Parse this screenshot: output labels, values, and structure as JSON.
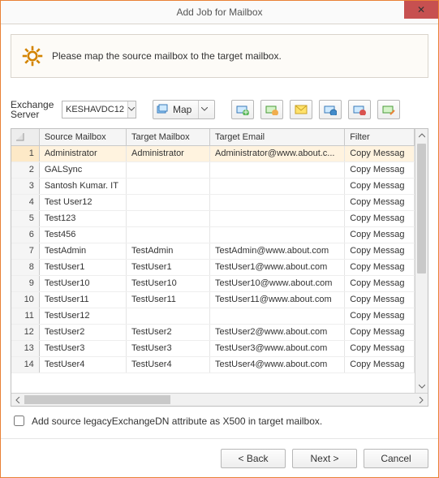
{
  "window": {
    "title": "Add Job for Mailbox"
  },
  "banner": {
    "text": "Please map the source mailbox to the target mailbox."
  },
  "server": {
    "label": "Exchange Server",
    "value": "KESHAVDC12"
  },
  "map_button": {
    "label": "Map"
  },
  "columns": {
    "rownum": "",
    "source": "Source Mailbox",
    "target": "Target Mailbox",
    "email": "Target Email",
    "filter": "Filter"
  },
  "rows": [
    {
      "n": "1",
      "src": "Administrator",
      "tgt": "Administrator",
      "email": "Administrator@www.about.c...",
      "filter": "Copy Messag"
    },
    {
      "n": "2",
      "src": "GALSync",
      "tgt": "",
      "email": "",
      "filter": "Copy Messag"
    },
    {
      "n": "3",
      "src": "Santosh Kumar. IT",
      "tgt": "",
      "email": "",
      "filter": "Copy Messag"
    },
    {
      "n": "4",
      "src": "Test User12",
      "tgt": "",
      "email": "",
      "filter": "Copy Messag"
    },
    {
      "n": "5",
      "src": "Test123",
      "tgt": "",
      "email": "",
      "filter": "Copy Messag"
    },
    {
      "n": "6",
      "src": "Test456",
      "tgt": "",
      "email": "",
      "filter": "Copy Messag"
    },
    {
      "n": "7",
      "src": "TestAdmin",
      "tgt": "TestAdmin",
      "email": "TestAdmin@www.about.com",
      "filter": "Copy Messag"
    },
    {
      "n": "8",
      "src": "TestUser1",
      "tgt": "TestUser1",
      "email": "TestUser1@www.about.com",
      "filter": "Copy Messag"
    },
    {
      "n": "9",
      "src": "TestUser10",
      "tgt": "TestUser10",
      "email": "TestUser10@www.about.com",
      "filter": "Copy Messag"
    },
    {
      "n": "10",
      "src": "TestUser11",
      "tgt": "TestUser11",
      "email": "TestUser11@www.about.com",
      "filter": "Copy Messag"
    },
    {
      "n": "11",
      "src": "TestUser12",
      "tgt": "",
      "email": "",
      "filter": "Copy Messag"
    },
    {
      "n": "12",
      "src": "TestUser2",
      "tgt": "TestUser2",
      "email": "TestUser2@www.about.com",
      "filter": "Copy Messag"
    },
    {
      "n": "13",
      "src": "TestUser3",
      "tgt": "TestUser3",
      "email": "TestUser3@www.about.com",
      "filter": "Copy Messag"
    },
    {
      "n": "14",
      "src": "TestUser4",
      "tgt": "TestUser4",
      "email": "TestUser4@www.about.com",
      "filter": "Copy Messag"
    }
  ],
  "checkbox": {
    "label": "Add source legacyExchangeDN attribute as X500 in target mailbox."
  },
  "footer": {
    "back": "< Back",
    "next": "Next >",
    "cancel": "Cancel"
  }
}
